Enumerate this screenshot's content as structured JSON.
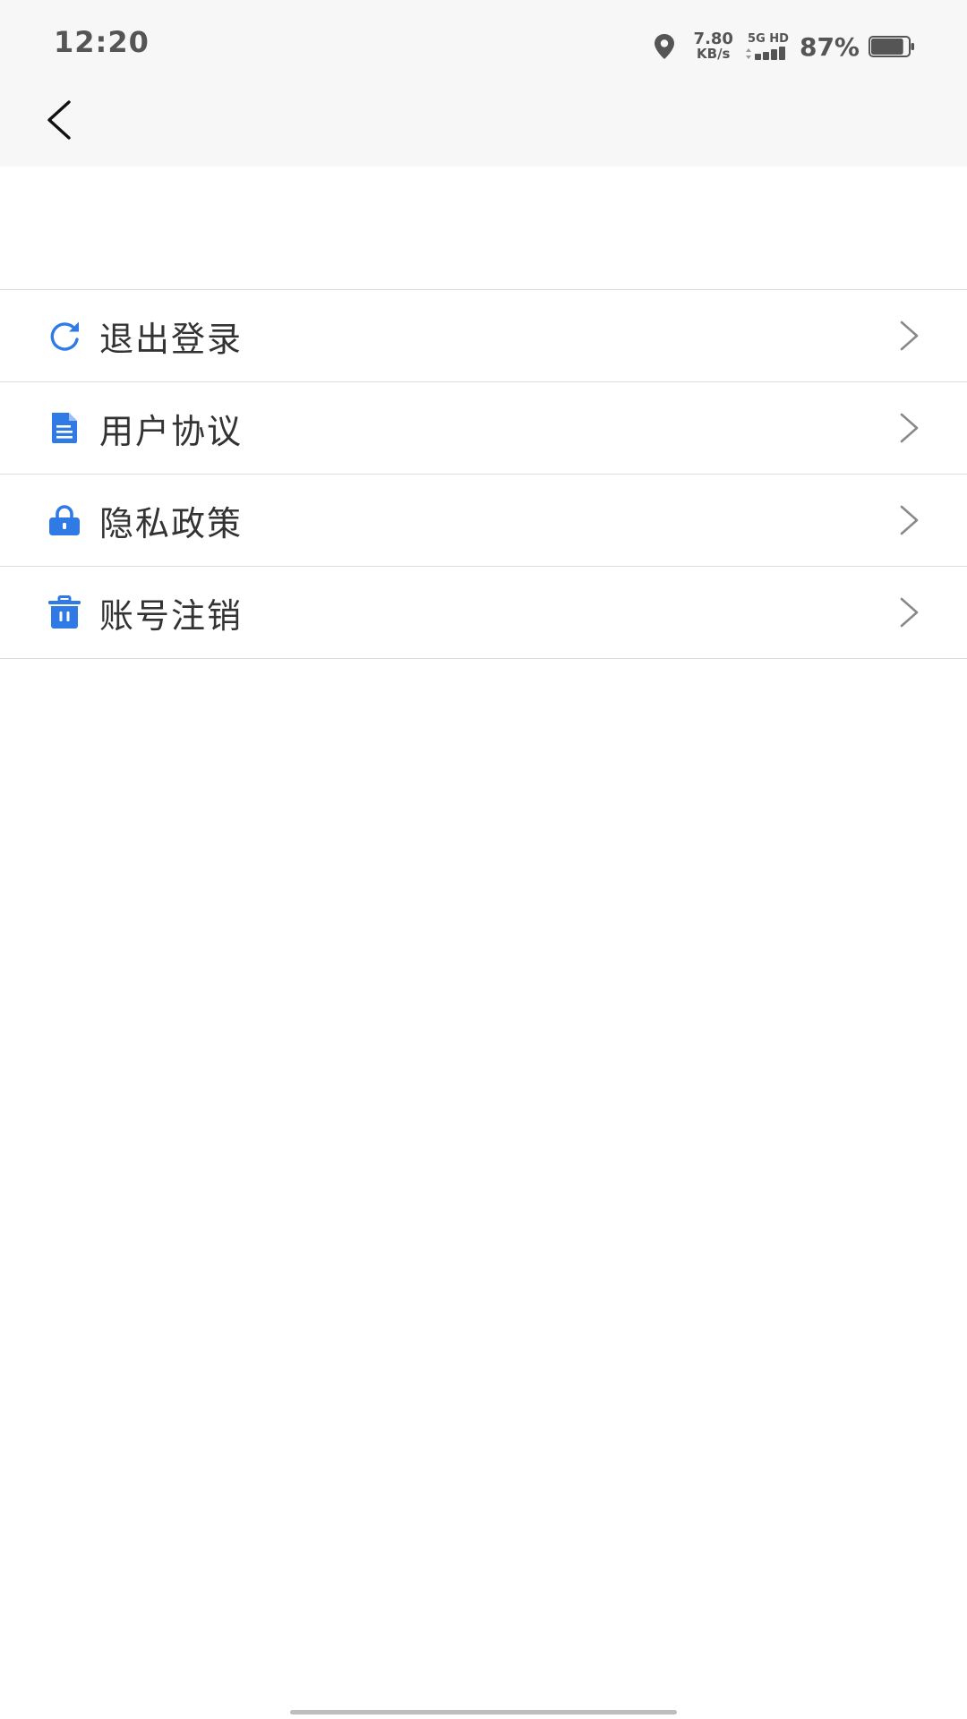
{
  "status_bar": {
    "time": "12:20",
    "net_speed_value": "7.80",
    "net_speed_unit": "KB/s",
    "network_label": "5G HD",
    "battery_percent": "87%",
    "battery_level": 0.87
  },
  "header": {
    "back_icon": "chevron-left-icon"
  },
  "menu": {
    "items": [
      {
        "label": "退出登录",
        "icon": "refresh-icon"
      },
      {
        "label": "用户协议",
        "icon": "document-icon"
      },
      {
        "label": "隐私政策",
        "icon": "lock-icon"
      },
      {
        "label": "账号注销",
        "icon": "trash-icon"
      }
    ]
  },
  "colors": {
    "accent": "#2f7ae5",
    "header_bg": "#f7f7f7",
    "text": "#333333",
    "divider": "#dcdcdc"
  }
}
